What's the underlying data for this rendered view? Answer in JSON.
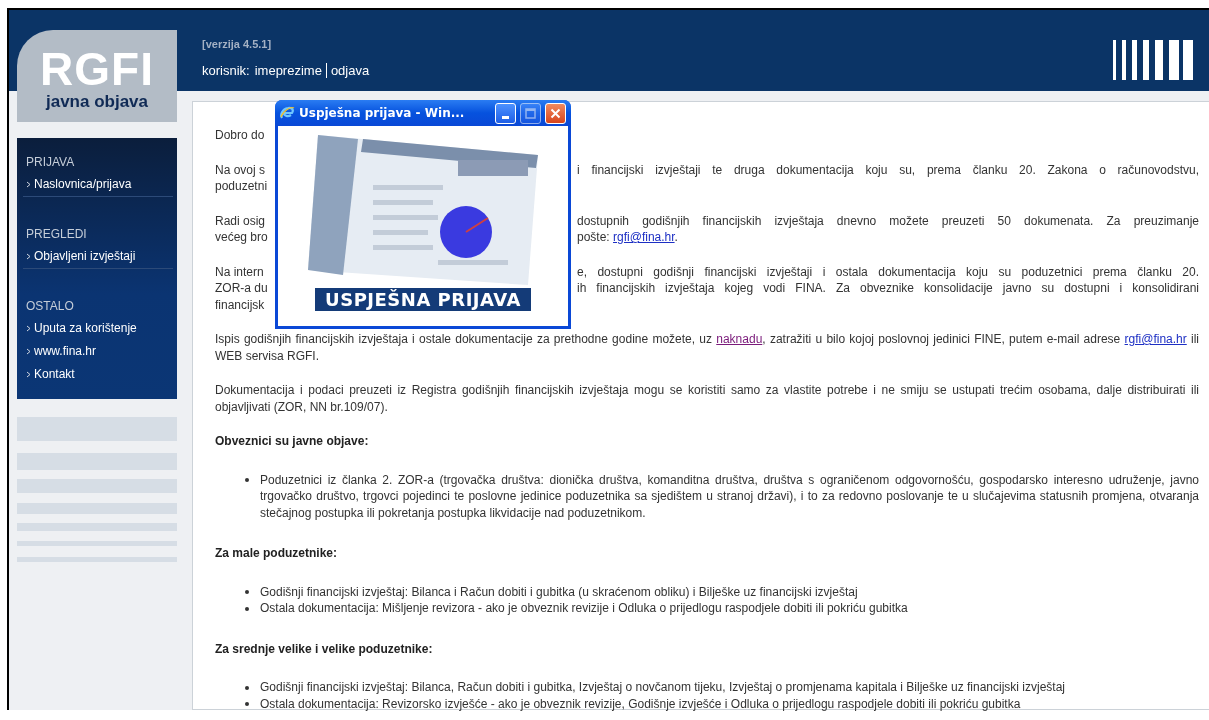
{
  "header": {
    "logo_title": "RGFI",
    "logo_subtitle": "javna objava",
    "version": "[verzija 4.5.1]",
    "user_label": "korisnik:",
    "user_name": "imeprezime",
    "logout": "odjava"
  },
  "sidebar": {
    "sections": [
      {
        "title": "PRIJAVA",
        "items": [
          "Naslovnica/prijava"
        ]
      },
      {
        "title": "PREGLEDI",
        "items": [
          "Objavljeni izvještaji"
        ]
      },
      {
        "title": "OSTALO",
        "items": [
          "Uputa za korištenje",
          "www.fina.hr",
          "Kontakt"
        ]
      }
    ]
  },
  "content": {
    "blocks": [
      {
        "kind": "lines",
        "lines": [
          {
            "left": "Dobro do"
          }
        ]
      },
      {
        "kind": "lines",
        "lines": [
          {
            "left": "Na ovoj s",
            "right": [
              {
                "kind": "text",
                "text": "i financijski izvještaji te druga dokumentacija koju su, prema članku 20. Zakona o računovodstvu,"
              }
            ]
          },
          {
            "left": "poduzetni"
          }
        ]
      },
      {
        "kind": "lines",
        "lines": [
          {
            "left": "Radi osig",
            "right": [
              {
                "kind": "text",
                "text": "dostupnih godišnjih financijskih izvještaja dnevno možete preuzeti 50 dokumenata. Za preuzimanje"
              }
            ]
          },
          {
            "left": "većeg bro",
            "right": [
              {
                "kind": "text",
                "text": "pošte: "
              },
              {
                "kind": "link",
                "text": "rgfi@fina.hr",
                "visited": false
              },
              {
                "kind": "text",
                "text": "."
              }
            ]
          }
        ]
      },
      {
        "kind": "lines",
        "lines": [
          {
            "left": "Na intern",
            "right": [
              {
                "kind": "text",
                "text": "e, dostupni godišnji financijski izvještaji i ostala dokumentacija koju su poduzetnici prema članku 20."
              }
            ]
          },
          {
            "left": "ZOR-a du",
            "right": [
              {
                "kind": "text",
                "text": "ih financijskih izvještaja kojeg vodi FINA. Za obveznike konsolidacije javno su dostupni i konsolidirani"
              }
            ]
          },
          {
            "left": "financijsk"
          }
        ]
      },
      {
        "kind": "paragraph",
        "segments": [
          {
            "kind": "text",
            "text": "Ispis godišnjih financijskih izvještaja i ostale dokumentacije za prethodne godine možete, uz "
          },
          {
            "kind": "link",
            "text": "naknadu",
            "visited": true
          },
          {
            "kind": "text",
            "text": ", zatražiti u bilo kojoj poslovnoj jedinici FINE, putem e-mail adrese "
          },
          {
            "kind": "link",
            "text": "rgfi@fina.hr",
            "visited": false
          },
          {
            "kind": "text",
            "text": " ili WEB servisa RGFI."
          }
        ]
      },
      {
        "kind": "paragraph",
        "segments": [
          {
            "kind": "text",
            "text": "Dokumentacija i podaci preuzeti iz Registra godišnjih financijskih izvještaja mogu se koristiti samo za vlastite potrebe i ne smiju se ustupati trećim osobama, dalje distribuirati ili objavljivati (ZOR, NN br.109/07)."
          }
        ]
      },
      {
        "kind": "heading",
        "text": "Obveznici su javne objave:"
      },
      {
        "kind": "bullets",
        "items": [
          "Poduzetnici iz članka 2. ZOR-a (trgovačka društva: dionička društva, komanditna društva, društva s ograničenom odgovornošću, gospodarsko interesno udruženje, javno trgovačko društvo, trgovci pojedinci te poslovne jedinice poduzetnika sa sjedištem u stranoj državi), i to za redovno poslovanje te u slučajevima statusnih promjena, otvaranja stečajnog postupka ili pokretanja postupka likvidacije nad poduzetnikom."
        ]
      },
      {
        "kind": "heading",
        "text": "Za male poduzetnike:"
      },
      {
        "kind": "bullets",
        "items": [
          "Godišnji financijski izvještaj: Bilanca i Račun dobiti i gubitka (u skraćenom obliku) i Bilješke uz financijski izvještaj",
          "Ostala dokumentacija: Mišljenje revizora - ako je obveznik revizije i Odluka o prijedlogu raspodjele dobiti ili pokriću gubitka"
        ]
      },
      {
        "kind": "heading",
        "text": "Za srednje velike i velike poduzetnike:"
      },
      {
        "kind": "bullets",
        "items": [
          "Godišnji financijski izvještaj: Bilanca, Račun dobiti i gubitka, Izvještaj o novčanom tijeku, Izvještaj o promjenama kapitala i Bilješke uz financijski izvještaj",
          "Ostala dokumentacija: Revizorsko izvješće - ako je obveznik revizije, Godišnje izvješće i Odluka o prijedlogu raspodjele dobiti ili pokriću gubitka"
        ]
      }
    ]
  },
  "popup": {
    "title": "Uspješna prijava - Win...",
    "buttons": [
      {
        "kind": "minimize",
        "disabled": false
      },
      {
        "kind": "maximize",
        "disabled": true
      },
      {
        "kind": "close",
        "disabled": false
      }
    ],
    "banner": "USPJEŠNA PRIJAVA"
  }
}
